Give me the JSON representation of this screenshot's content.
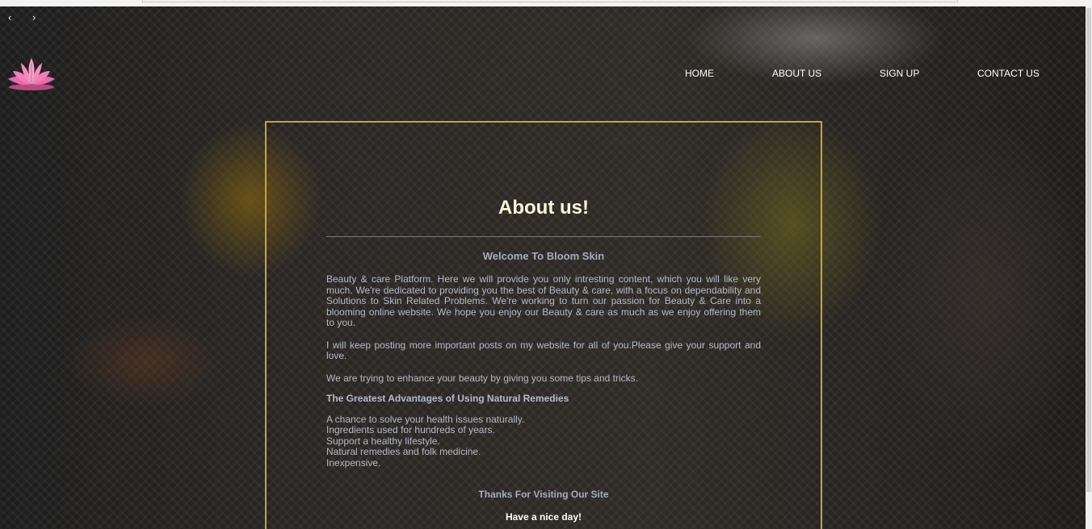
{
  "nav": {
    "back_arrow": "‹",
    "forward_arrow": "›",
    "logo_icon": "lotus-icon",
    "items": [
      "HOME",
      "ABOUT US",
      "SIGN UP",
      "CONTACT US"
    ]
  },
  "about": {
    "title": "About us!",
    "welcome": "Welcome To Bloom Skin",
    "paragraphs": [
      "Beauty & care Platform. Here we will provide you only intresting content, which you will like very much. We're dedicated to providing you the best of Beauty & care, with a focus on dependability and Solutions to Skin Related Problems. We're working to turn our passion for Beauty & Care into a blooming online website. We hope you enjoy our Beauty & care as much as we enjoy offering them to you.",
      "I will keep posting more important posts on my website for all of you.Please give your support and love.",
      "We are trying to enhance your beauty by giving you some tips and tricks."
    ],
    "advantages_heading": "The Greatest Advantages of Using Natural Remedies",
    "advantages": [
      "A chance to solve your health issues naturally.",
      "Ingredients used for hundreds of years.",
      "Support a healthy lifestyle.",
      "Natural remedies and folk medicine.",
      "Inexpensive."
    ],
    "thanks": "Thanks For Visiting Our Site",
    "closing": "Have a nice day!"
  },
  "colors": {
    "accent_border": "#c9a13f",
    "logo_pink": "#e86aa8"
  }
}
